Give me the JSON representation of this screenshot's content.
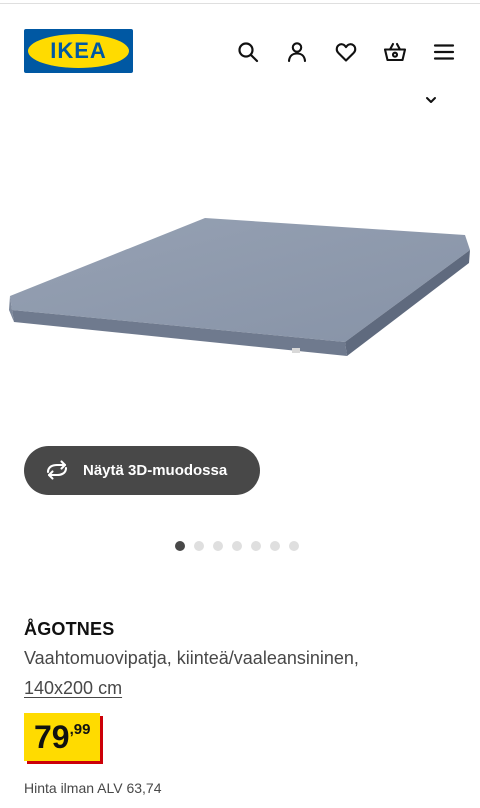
{
  "header": {
    "logo_text": "IKEA",
    "icons": [
      "search-icon",
      "user-icon",
      "heart-icon",
      "basket-icon",
      "menu-icon"
    ]
  },
  "gallery": {
    "view_3d_label": "Näytä 3D-muodossa",
    "dot_count": 7,
    "active_dot": 1
  },
  "product": {
    "name": "ÅGOTNES",
    "description": "Vaahtomuovipatja, kiinteä/vaaleansininen,",
    "size": "140x200 cm",
    "price_integer": "79",
    "price_decimals": ",99",
    "price_ex_vat": "Hinta ilman ALV 63,74"
  },
  "colors": {
    "brand_blue": "#0058a3",
    "brand_yellow": "#ffdb00",
    "price_shadow": "#cc0008",
    "dark_button": "#484848",
    "mattress": "#8e99ab"
  }
}
